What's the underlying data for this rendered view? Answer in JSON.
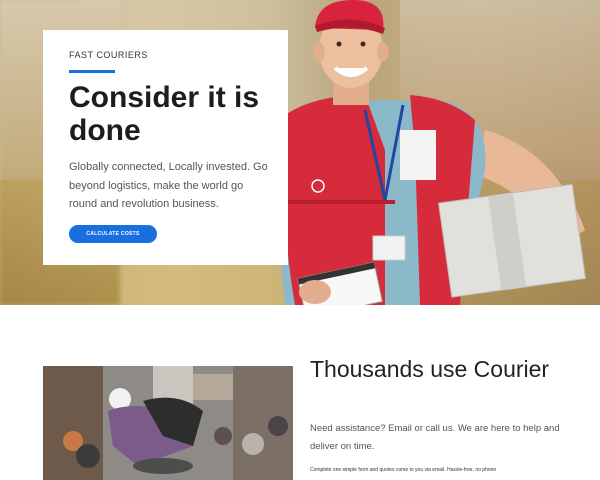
{
  "hero": {
    "kicker": "FAST COURIERS",
    "headline": "Consider it is done",
    "intro": "Globally connected, Locally invested. Go beyond logistics, make the world go round and revolution business.",
    "cta_label": "CALCULATE COSTS"
  },
  "section": {
    "title": "Thousands use Courier",
    "text": "Need assistance? Email or call us. We are here to help and deliver on time.",
    "small_text": "Complete one simple form and quotes come to you via email. Hassle-free, no phone"
  },
  "colors": {
    "accent": "#1a6fe0",
    "vest_red": "#d62b3a",
    "cap_red": "#d9223b",
    "shirt_blue": "#7fb0c4"
  }
}
